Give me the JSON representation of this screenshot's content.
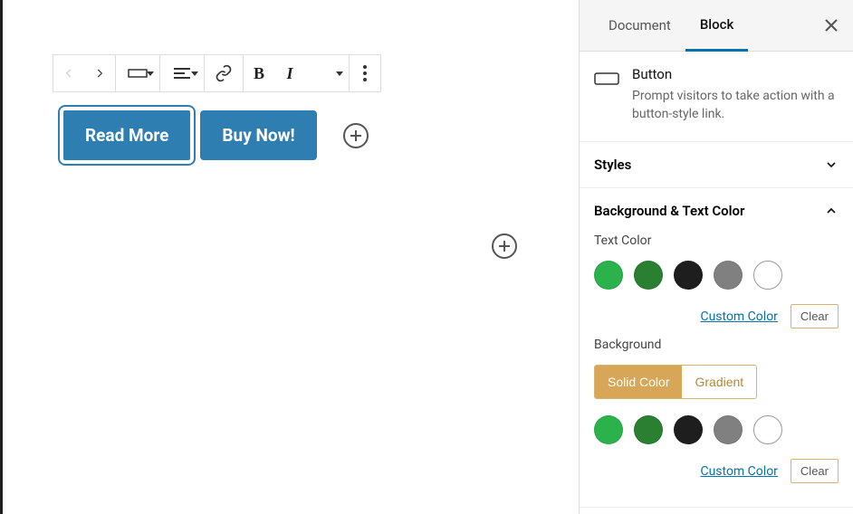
{
  "sidebar": {
    "tabs": {
      "document": "Document",
      "block": "Block"
    },
    "block_info": {
      "title": "Button",
      "description": "Prompt visitors to take action with a button-style link."
    },
    "panels": {
      "styles": {
        "title": "Styles"
      },
      "colors": {
        "title": "Background & Text Color",
        "text_color_label": "Text Color",
        "background_label": "Background",
        "custom_color": "Custom Color",
        "clear": "Clear",
        "bg_toggle": {
          "solid": "Solid Color",
          "gradient": "Gradient"
        },
        "swatches": [
          "#2bb24c",
          "#2a7f31",
          "#1e1e1e",
          "#808080",
          "#ffffff"
        ]
      }
    }
  },
  "canvas": {
    "buttons": [
      {
        "text": "Read More"
      },
      {
        "text": "Buy Now!"
      }
    ]
  }
}
